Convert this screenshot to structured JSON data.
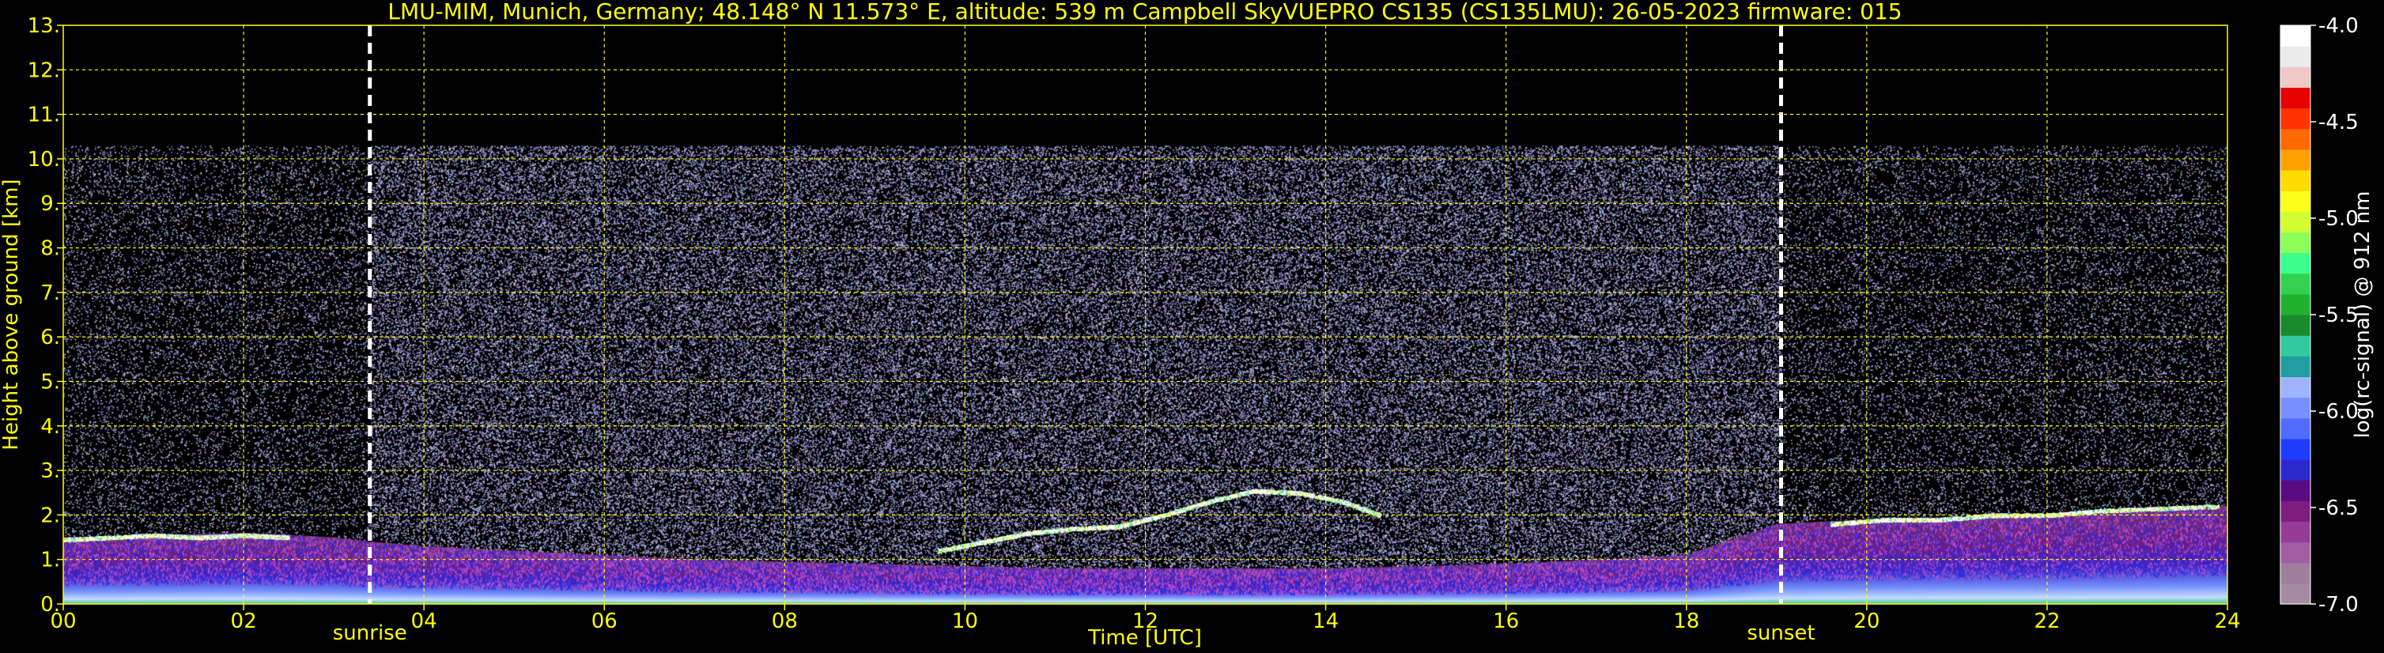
{
  "chart_data": {
    "type": "heatmap",
    "title": "LMU-MIM, Munich, Germany; 48.148° N 11.573° E, altitude: 539 m    Campbell SkyVUEPRO CS135 (CS135LMU): 26-05-2023    firmware: 015",
    "xlabel": "Time [UTC]",
    "ylabel": "Height above ground [km]",
    "xlim": [
      0,
      24
    ],
    "ylim": [
      0,
      13
    ],
    "x_ticks": [
      0,
      2,
      4,
      6,
      8,
      10,
      12,
      14,
      16,
      18,
      20,
      22,
      24
    ],
    "x_tick_labels": [
      "00",
      "02",
      "04",
      "06",
      "08",
      "10",
      "12",
      "14",
      "16",
      "18",
      "20",
      "22",
      "24"
    ],
    "y_ticks": [
      0,
      1,
      2,
      3,
      4,
      5,
      6,
      7,
      8,
      9,
      10,
      11,
      12,
      13
    ],
    "y_tick_labels": [
      "0.",
      "1.",
      "2.",
      "3.",
      "4.",
      "5.",
      "6.",
      "7.",
      "8.",
      "9.",
      "10.",
      "11.",
      "12.",
      "13."
    ],
    "grid": true,
    "grid_color": "#ffff00",
    "background": "#000000",
    "signal_top_km": 10.3,
    "boundary_layer": {
      "times": [
        0,
        1,
        2,
        3,
        3.4,
        4,
        5,
        6,
        7,
        8,
        9,
        10,
        11,
        12,
        13,
        14,
        15,
        16,
        17,
        18,
        19,
        19.5,
        20,
        21,
        22,
        23,
        24
      ],
      "top_km": [
        1.5,
        1.55,
        1.6,
        1.5,
        1.4,
        1.3,
        1.2,
        1.1,
        1.0,
        0.95,
        0.9,
        0.85,
        0.8,
        0.8,
        0.8,
        0.8,
        0.85,
        0.9,
        1.0,
        1.1,
        1.8,
        1.85,
        1.9,
        1.95,
        2.0,
        2.1,
        2.2
      ]
    },
    "cloud_layer": {
      "times": [
        0.0,
        0.5,
        1.0,
        1.5,
        2.0,
        2.5,
        9.7,
        10.2,
        10.7,
        11.2,
        11.7,
        12.2,
        12.7,
        13.2,
        13.7,
        14.2,
        14.6,
        19.6,
        20.2,
        20.8,
        21.4,
        22.0,
        22.6,
        23.2,
        23.9
      ],
      "height_km": [
        1.45,
        1.5,
        1.55,
        1.5,
        1.55,
        1.5,
        1.2,
        1.4,
        1.6,
        1.7,
        1.75,
        2.0,
        2.3,
        2.55,
        2.5,
        2.3,
        2.0,
        1.8,
        1.9,
        1.9,
        2.0,
        2.0,
        2.1,
        2.15,
        2.2
      ]
    },
    "events": [
      {
        "label": "sunrise",
        "time": 3.4
      },
      {
        "label": "sunset",
        "time": 19.05
      }
    ],
    "colorbar": {
      "label": "log(rc-signal) @ 912 nm",
      "range": [
        -7.0,
        -4.0
      ],
      "ticks": [
        -4.0,
        -4.5,
        -5.0,
        -5.5,
        -6.0,
        -6.5,
        -7.0
      ],
      "tick_labels": [
        "-4.0",
        "-4.5",
        "-5.0",
        "-5.5",
        "-6.0",
        "-6.5",
        "-7.0"
      ],
      "colors_bottom_to_top": [
        "#a68aa4",
        "#9f7fa0",
        "#a05fa0",
        "#963c96",
        "#7d1e7d",
        "#5a0a82",
        "#2828cc",
        "#1e3cff",
        "#4f6cff",
        "#7890ff",
        "#9eb4ff",
        "#1e9ea0",
        "#32c8a0",
        "#1a8a2a",
        "#22b030",
        "#32d250",
        "#3cff8c",
        "#8cff5a",
        "#d2ff32",
        "#ffff1e",
        "#ffdc00",
        "#ffa000",
        "#ff6a00",
        "#ff3200",
        "#e60000",
        "#f0c8c8",
        "#ebebeb",
        "#ffffff"
      ]
    }
  }
}
